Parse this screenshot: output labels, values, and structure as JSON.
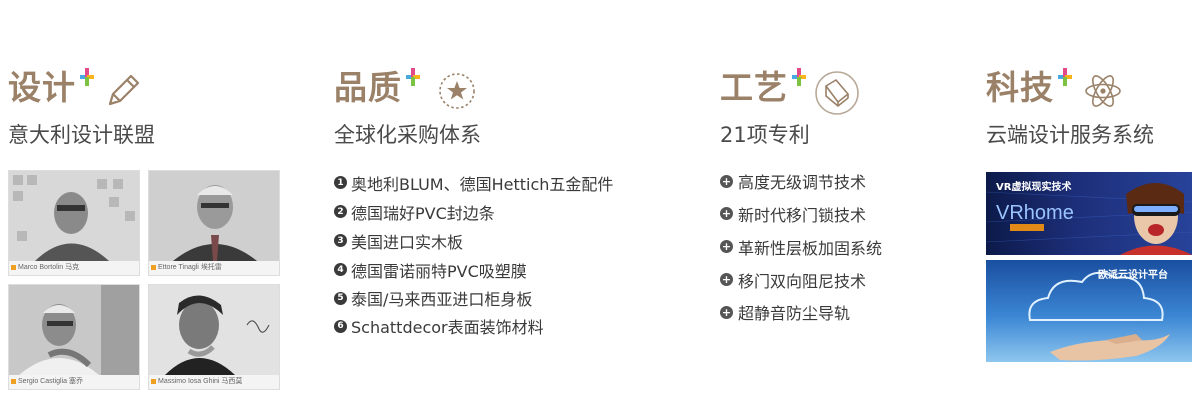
{
  "design": {
    "title": "设计",
    "subtitle": "意大利设计联盟",
    "icon": "pencil-icon",
    "designers": [
      {
        "name": "Marco Bortolin",
        "cn": "马克"
      },
      {
        "name": "Ettore Tinagli",
        "cn": "埃托雷"
      },
      {
        "name": "Sergio Castiglia",
        "cn": "塞乔"
      },
      {
        "name": "Massimo Iosa Ghini",
        "cn": "马西莫"
      }
    ]
  },
  "quality": {
    "title": "品质",
    "subtitle": "全球化采购体系",
    "icon": "star-circle-icon",
    "items": [
      {
        "num": "1",
        "text": "奥地利BLUM、德国Hettich五金配件"
      },
      {
        "num": "2",
        "text": "德国瑞好PVC封边条"
      },
      {
        "num": "3",
        "text": "美国进口实木板"
      },
      {
        "num": "4",
        "text": "德国雷诺丽特PVC吸塑膜"
      },
      {
        "num": "5",
        "text": "泰国/马来西亚进口柜身板"
      },
      {
        "num": "6",
        "text": "Schattdecor表面装饰材料"
      }
    ]
  },
  "craft": {
    "title": "工艺",
    "subtitle": "21项专利",
    "icon": "cube-icon",
    "items": [
      {
        "text": "高度无级调节技术"
      },
      {
        "text": "新时代移门锁技术"
      },
      {
        "text": "革新性层板加固系统"
      },
      {
        "text": "移门双向阻尼技术"
      },
      {
        "text": "超静音防尘导轨"
      }
    ]
  },
  "tech": {
    "title": "科技",
    "subtitle": "云端设计服务系统",
    "icon": "atom-icon",
    "banners": [
      {
        "label": "VR虚拟现实技术",
        "logo": "VRhome"
      },
      {
        "label": "欧派云设计平台"
      }
    ]
  },
  "colors": {
    "title": "#9a8168",
    "text": "#3a3a3a"
  }
}
